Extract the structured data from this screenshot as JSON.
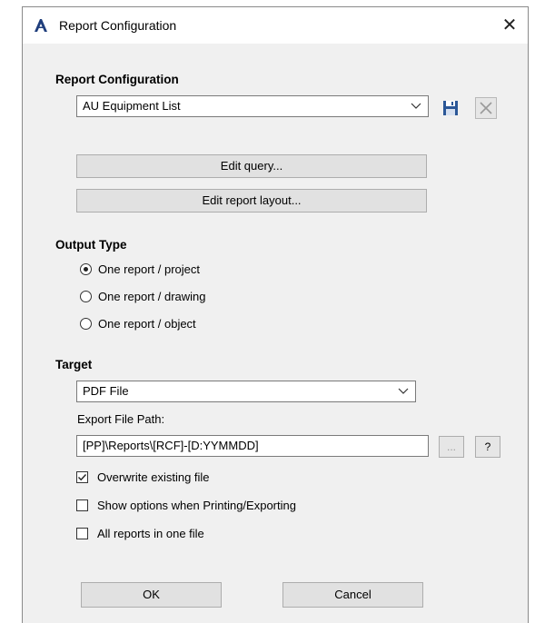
{
  "window": {
    "title": "Report Configuration",
    "close_glyph": "✕"
  },
  "report_config": {
    "heading": "Report Configuration",
    "selected": "AU Equipment List",
    "edit_query_label": "Edit query...",
    "edit_layout_label": "Edit report layout..."
  },
  "output_type": {
    "heading": "Output Type",
    "options": [
      {
        "label": "One report / project",
        "selected": true
      },
      {
        "label": "One report / drawing",
        "selected": false
      },
      {
        "label": "One report / object",
        "selected": false
      }
    ]
  },
  "target": {
    "heading": "Target",
    "selected": "PDF File",
    "export_path_label": "Export File Path:",
    "export_path_value": "[PP]\\Reports\\[RCF]-[D:YYMMDD]",
    "browse_label": "...",
    "help_label": "?",
    "options": [
      {
        "label": "Overwrite existing file",
        "checked": true
      },
      {
        "label": "Show options when Printing/Exporting",
        "checked": false
      },
      {
        "label": "All reports in one file",
        "checked": false
      }
    ]
  },
  "footer": {
    "ok_label": "OK",
    "cancel_label": "Cancel"
  },
  "icons": {
    "app": "autocad-a-icon",
    "save": "floppy-save-icon",
    "delete": "x-delete-icon",
    "dropdown": "chevron-down-icon"
  },
  "colors": {
    "dialog_bg": "#f0f0f0",
    "button_bg": "#e1e1e1",
    "app_icon": "#1f3e7c",
    "save_icon": "#2b5797"
  }
}
